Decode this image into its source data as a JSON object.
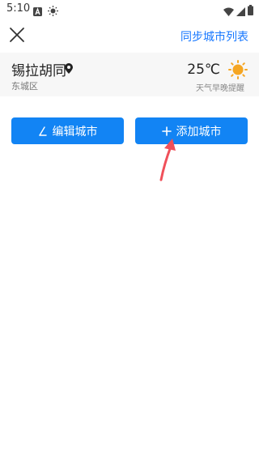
{
  "status_bar": {
    "time": "5:10",
    "left_icons": [
      "notification-a-icon",
      "brightness-icon"
    ],
    "right_icons": [
      "wifi-icon",
      "signal-icon",
      "battery-icon"
    ]
  },
  "top_bar": {
    "close_icon": "close-icon",
    "sync_label": "同步城市列表"
  },
  "city": {
    "name": "锡拉胡同",
    "location_icon": "location-pin-icon",
    "district": "东城区",
    "temperature": "25℃",
    "weather_icon": "sun-icon",
    "reminder": "天气早晚提醒"
  },
  "actions": {
    "edit_label": "编辑城市",
    "add_label": "添加城市"
  },
  "colors": {
    "accent": "#1284f4",
    "link": "#1677ff",
    "sun": "#f5a623",
    "annotation_arrow": "#f0505a"
  }
}
